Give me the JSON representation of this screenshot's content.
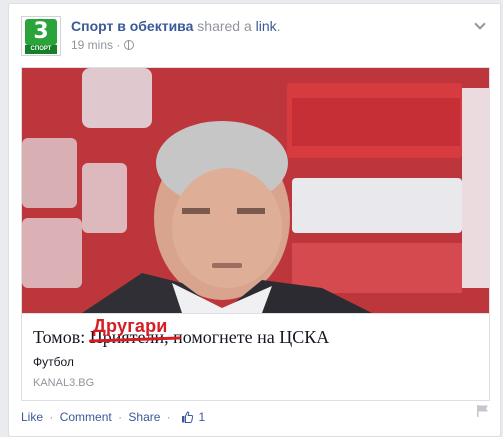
{
  "post": {
    "page_name": "Спорт в обектива",
    "shared_text": "shared a",
    "link_word": "link",
    "timestamp": "19 mins",
    "dot": "·",
    "avatar": {
      "number": "3",
      "label": "СПОРТ"
    }
  },
  "link_card": {
    "title": "Томов: Приятели, помогнете на ЦСКА",
    "overlay_word": "Другари",
    "category": "Футбол",
    "domain": "KANAL3.BG"
  },
  "actions": {
    "like": "Like",
    "comment": "Comment",
    "share": "Share",
    "separator": "·",
    "like_count": "1"
  },
  "colors": {
    "link_blue": "#3b5998",
    "meta_gray": "#90949c",
    "overlay_red": "#d51d23",
    "brand_green": "#2aa33b"
  }
}
